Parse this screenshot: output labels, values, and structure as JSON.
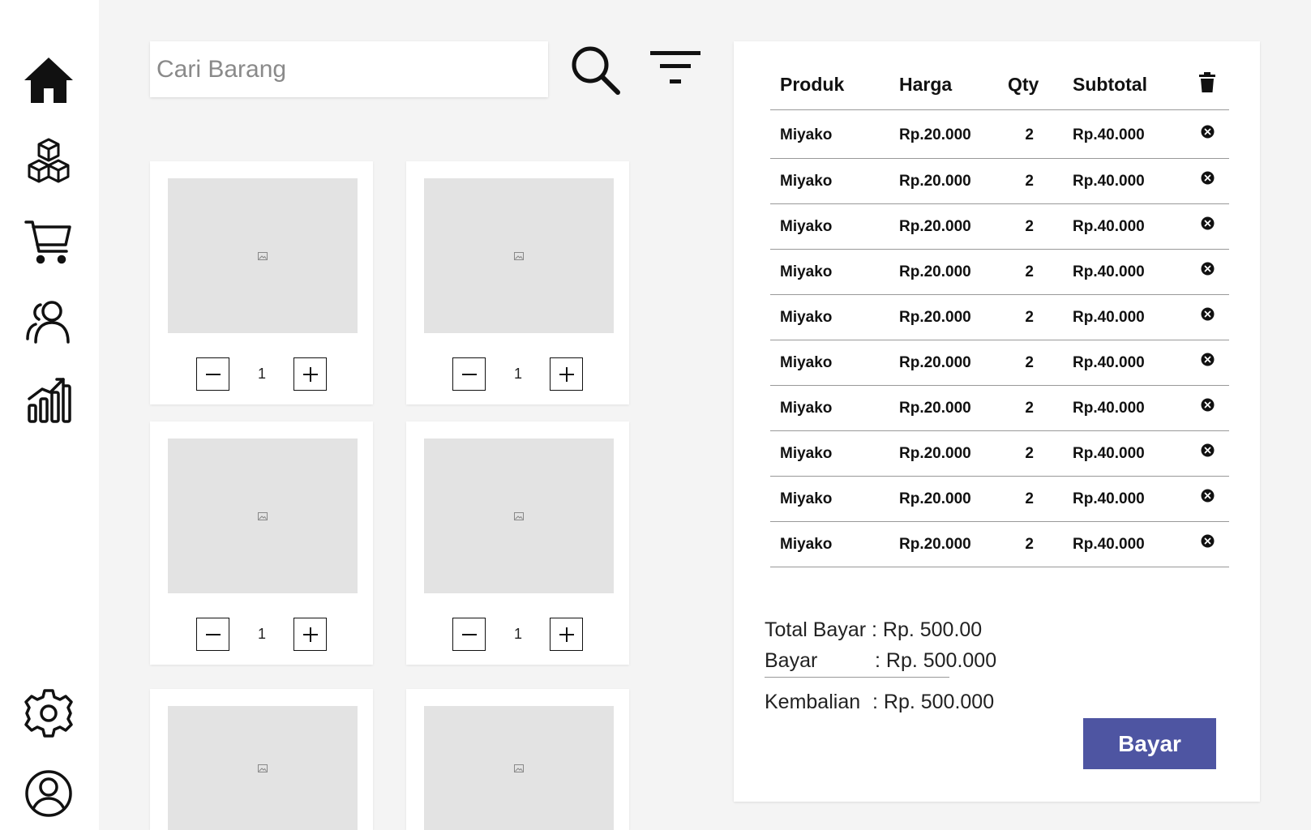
{
  "sidebar": {
    "items": [
      {
        "icon": "home-icon"
      },
      {
        "icon": "boxes-icon"
      },
      {
        "icon": "cart-icon"
      },
      {
        "icon": "users-icon"
      },
      {
        "icon": "chart-icon"
      },
      {
        "icon": "settings-icon"
      },
      {
        "icon": "profile-icon"
      }
    ]
  },
  "search": {
    "placeholder": "Cari Barang"
  },
  "products": [
    {
      "qty": "1"
    },
    {
      "qty": "1"
    },
    {
      "qty": "1"
    },
    {
      "qty": "1"
    },
    {
      "qty": ""
    },
    {
      "qty": ""
    }
  ],
  "cart": {
    "headers": {
      "product": "Produk",
      "price": "Harga",
      "qty": "Qty",
      "subtotal": "Subtotal"
    },
    "rows": [
      {
        "product": "Miyako",
        "price": "Rp.20.000",
        "qty": "2",
        "subtotal": "Rp.40.000"
      },
      {
        "product": "Miyako",
        "price": "Rp.20.000",
        "qty": "2",
        "subtotal": "Rp.40.000"
      },
      {
        "product": "Miyako",
        "price": "Rp.20.000",
        "qty": "2",
        "subtotal": "Rp.40.000"
      },
      {
        "product": "Miyako",
        "price": "Rp.20.000",
        "qty": "2",
        "subtotal": "Rp.40.000"
      },
      {
        "product": "Miyako",
        "price": "Rp.20.000",
        "qty": "2",
        "subtotal": "Rp.40.000"
      },
      {
        "product": "Miyako",
        "price": "Rp.20.000",
        "qty": "2",
        "subtotal": "Rp.40.000"
      },
      {
        "product": "Miyako",
        "price": "Rp.20.000",
        "qty": "2",
        "subtotal": "Rp.40.000"
      },
      {
        "product": "Miyako",
        "price": "Rp.20.000",
        "qty": "2",
        "subtotal": "Rp.40.000"
      },
      {
        "product": "Miyako",
        "price": "Rp.20.000",
        "qty": "2",
        "subtotal": "Rp.40.000"
      },
      {
        "product": "Miyako",
        "price": "Rp.20.000",
        "qty": "2",
        "subtotal": "Rp.40.000"
      }
    ],
    "summary": {
      "total_label": "Total Bayar : Rp. 500.00",
      "pay_label": "Bayar",
      "pay_value": ": Rp. 500.000",
      "change_label": "Kembalian",
      "change_value": ": Rp. 500.000"
    },
    "pay_button": "Bayar"
  },
  "colors": {
    "accent": "#4e55a2",
    "background": "#f4f4f4",
    "placeholder": "#e3e3e3"
  }
}
